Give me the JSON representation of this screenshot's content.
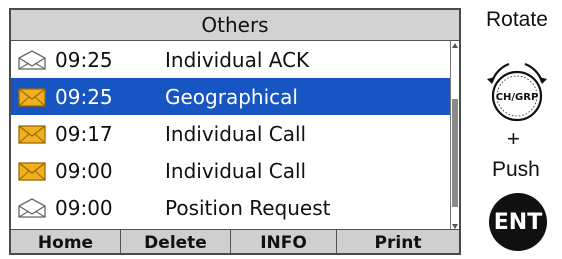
{
  "screen": {
    "title": "Others",
    "messages": [
      {
        "time": "09:25",
        "description": "Individual ACK",
        "icon": "envelope-read-icon",
        "selected": false
      },
      {
        "time": "09:25",
        "description": "Geographical",
        "icon": "envelope-unread-icon",
        "selected": true
      },
      {
        "time": "09:17",
        "description": "Individual Call",
        "icon": "envelope-unread-icon",
        "selected": false
      },
      {
        "time": "09:00",
        "description": "Individual Call",
        "icon": "envelope-unread-icon",
        "selected": false
      },
      {
        "time": "09:00",
        "description": "Position Request",
        "icon": "envelope-read-icon",
        "selected": false
      }
    ],
    "soft_keys": [
      "Home",
      "Delete",
      "INFO",
      "Print"
    ]
  },
  "controls": {
    "rotate_label": "Rotate",
    "knob_label": "CH/GRP",
    "plus": "+",
    "push_label": "Push",
    "ent_label": "ENT"
  },
  "colors": {
    "selection": "#1756c2",
    "title_bar": "#d2d2d2",
    "soft_key_bar": "#cfcfcf",
    "unread_envelope": "#f0b020",
    "read_envelope": "#ffffff"
  }
}
